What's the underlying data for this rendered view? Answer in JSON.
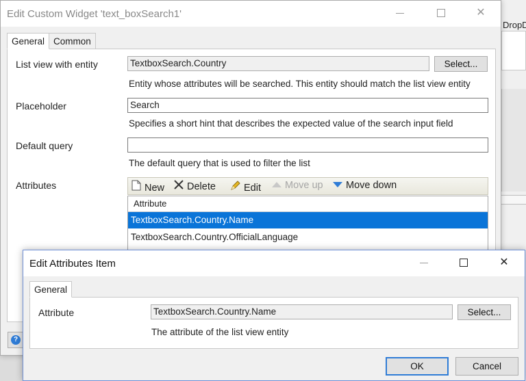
{
  "main_dialog": {
    "title": "Edit Custom Widget 'text_boxSearch1'",
    "tabs": [
      "General",
      "Common"
    ],
    "list_view_label": "List view with entity",
    "list_view_value": "TextboxSearch.Country",
    "select_label": "Select...",
    "list_view_help": "Entity whose attributes will be searched. This entity should match the list view entity",
    "placeholder_label": "Placeholder",
    "placeholder_value": "Search",
    "placeholder_help": "Specifies a short hint that describes the expected value of the search input field",
    "default_query_label": "Default query",
    "default_query_value": "",
    "default_query_help": "The default query that is used to filter the list",
    "attributes_label": "Attributes",
    "toolbar": {
      "new": "New",
      "delete": "Delete",
      "edit": "Edit",
      "move_up": "Move up",
      "move_down": "Move down"
    },
    "grid": {
      "header": "Attribute",
      "rows": [
        "TextboxSearch.Country.Name",
        "TextboxSearch.Country.OfficialLanguage"
      ]
    }
  },
  "background": {
    "right_tab_text": "DropD"
  },
  "attr_dialog": {
    "title": "Edit Attributes Item",
    "tab": "General",
    "attribute_label": "Attribute",
    "attribute_value": "TextboxSearch.Country.Name",
    "select_label": "Select...",
    "attribute_help": "The attribute of the list view entity",
    "ok_label": "OK",
    "cancel_label": "Cancel"
  }
}
